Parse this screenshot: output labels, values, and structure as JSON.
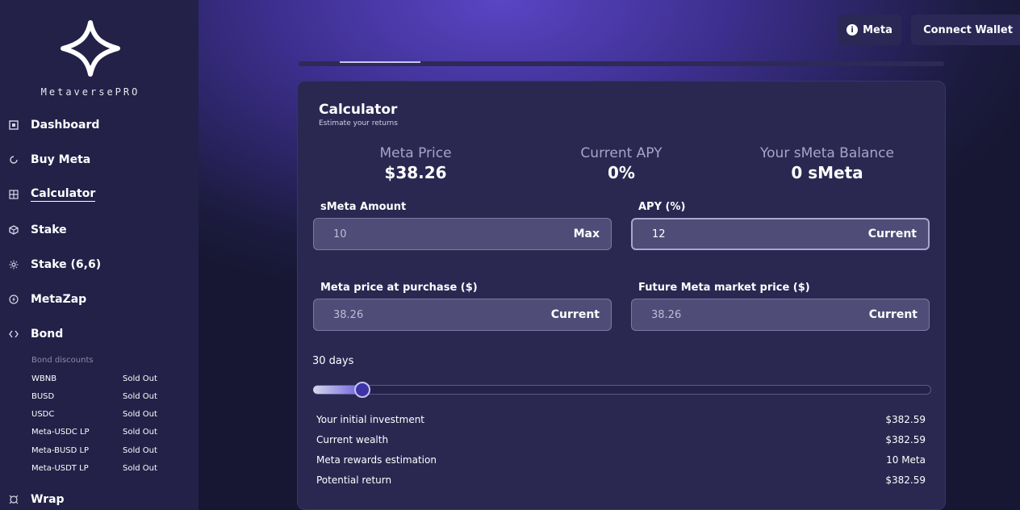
{
  "brand": {
    "name": "MetaversePRO"
  },
  "nav": {
    "items": [
      {
        "label": "Dashboard",
        "icon": "dashboard-icon",
        "active": false
      },
      {
        "label": "Buy Meta",
        "icon": "buy-icon",
        "active": false
      },
      {
        "label": "Calculator",
        "icon": "calculator-icon",
        "active": true
      },
      {
        "label": "Stake",
        "icon": "stake-icon",
        "active": false
      },
      {
        "label": "Stake (6,6)",
        "icon": "stake66-icon",
        "active": false
      },
      {
        "label": "MetaZap",
        "icon": "zap-icon",
        "active": false
      },
      {
        "label": "Bond",
        "icon": "bond-icon",
        "active": false
      }
    ],
    "bond_discounts_label": "Bond discounts",
    "bonds": [
      {
        "name": "WBNB",
        "status": "Sold Out"
      },
      {
        "name": "BUSD",
        "status": "Sold Out"
      },
      {
        "name": "USDC",
        "status": "Sold Out"
      },
      {
        "name": "Meta-USDC LP",
        "status": "Sold Out"
      },
      {
        "name": "Meta-BUSD LP",
        "status": "Sold Out"
      },
      {
        "name": "Meta-USDT LP",
        "status": "Sold Out"
      }
    ],
    "wrap_label": "Wrap"
  },
  "header": {
    "meta_button": "Meta",
    "connect_wallet": "Connect Wallet"
  },
  "calculator": {
    "title": "Calculator",
    "subtitle": "Estimate your returns",
    "stats": [
      {
        "label": "Meta Price",
        "value": "$38.26"
      },
      {
        "label": "Current APY",
        "value": "0%"
      },
      {
        "label": "Your sMeta Balance",
        "value": "0 sMeta"
      }
    ],
    "fields": {
      "smeta_amount": {
        "label": "sMeta Amount",
        "value": "10",
        "button": "Max"
      },
      "apy": {
        "label": "APY (%)",
        "value": "12",
        "button": "Current"
      },
      "purchase_price": {
        "label": "Meta price at purchase ($)",
        "value": "38.26",
        "button": "Current"
      },
      "future_price": {
        "label": "Future Meta market price ($)",
        "value": "38.26",
        "button": "Current"
      }
    },
    "days_label": "30 days",
    "slider_fraction": 0.08,
    "results": [
      {
        "label": "Your initial investment",
        "value": "$382.59"
      },
      {
        "label": "Current wealth",
        "value": "$382.59"
      },
      {
        "label": "Meta rewards estimation",
        "value": "10 Meta"
      },
      {
        "label": "Potential return",
        "value": "$382.59"
      }
    ]
  },
  "colors": {
    "sidebar": "#232148",
    "card": "#2a2851",
    "field": "#4f4d77",
    "accent": "#3e34a8"
  }
}
